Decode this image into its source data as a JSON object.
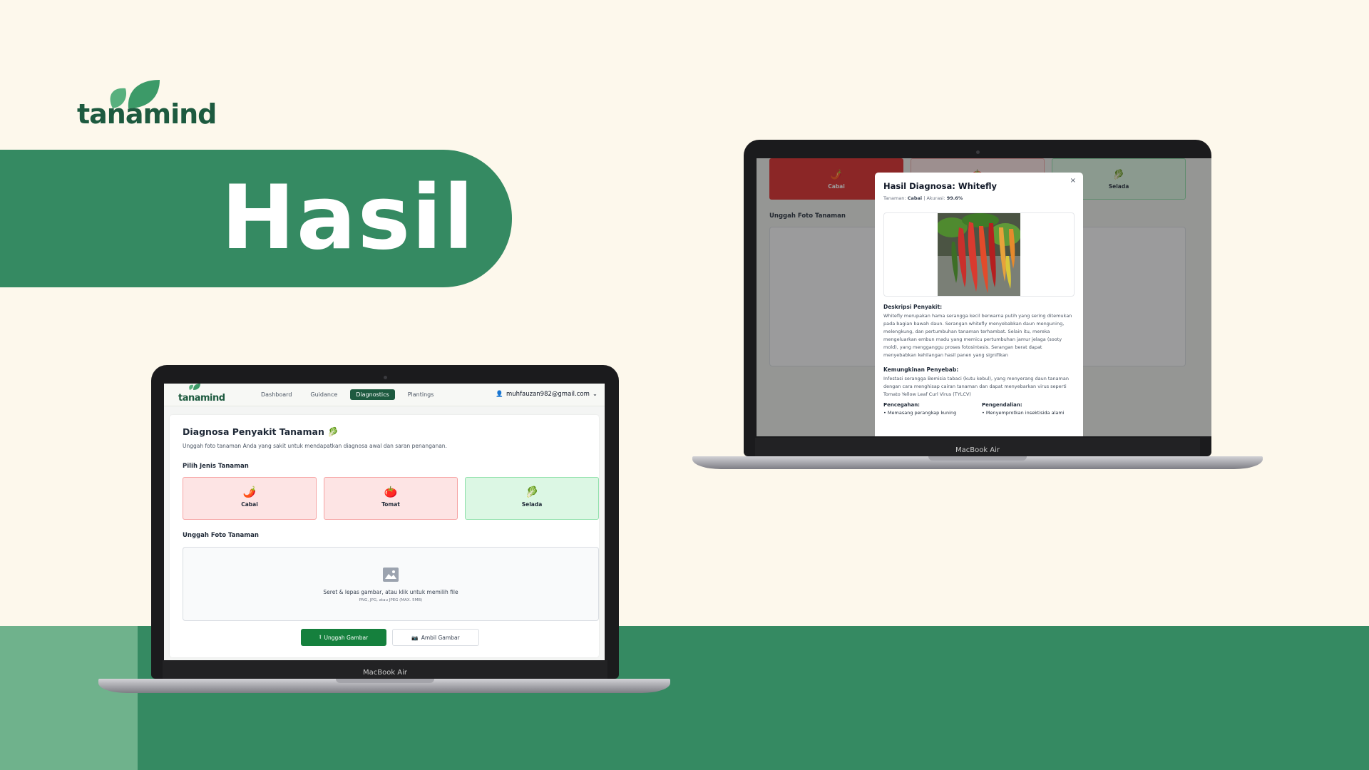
{
  "brand": {
    "name": "tanamind"
  },
  "hero": {
    "title": "Hasil"
  },
  "laptop_left": {
    "device_label": "MacBook Air",
    "nav": {
      "logo": "tanamind",
      "links": [
        "Dashboard",
        "Guidance",
        "Diagnostics",
        "Plantings"
      ],
      "active": "Diagnostics",
      "user_email": "muhfauzan982@gmail.com"
    },
    "page": {
      "title": "Diagnosa Penyakit Tanaman 🥬",
      "subtitle": "Unggah foto tanaman Anda yang sakit untuk mendapatkan diagnosa awal dan saran penanganan.",
      "select_label": "Pilih Jenis Tanaman",
      "plants": [
        {
          "emoji": "🌶️",
          "label": "Cabai"
        },
        {
          "emoji": "🍅",
          "label": "Tomat"
        },
        {
          "emoji": "🥬",
          "label": "Selada"
        }
      ],
      "upload_label": "Unggah Foto Tanaman",
      "upload_hint": "Seret & lepas gambar, atau klik untuk memilih file",
      "upload_formats": "PNG, JPG, atau JPEG (MAX. 5MB)",
      "upload_button": "Unggah Gambar",
      "camera_button": "Ambil Gambar"
    }
  },
  "laptop_right": {
    "device_label": "MacBook Air",
    "background": {
      "plants": [
        {
          "emoji": "🌶️",
          "label": "Cabai"
        },
        {
          "emoji": "🍅",
          "label": ""
        },
        {
          "emoji": "🥬",
          "label": "Selada"
        }
      ],
      "upload_label": "Unggah Foto Tanaman"
    },
    "modal": {
      "title": "Hasil Diagnosa: Whitefly",
      "close": "×",
      "meta_plant_label": "Tanaman:",
      "meta_plant": "Cabai",
      "meta_acc_label": "| Akurasi:",
      "meta_acc": "99.6%",
      "desc_heading": "Deskripsi Penyakit:",
      "desc_text": "Whitefly merupakan hama serangga kecil berwarna putih yang sering ditemukan pada bagian bawah daun. Serangan whitefly menyebabkan daun menguning, melengkung, dan pertumbuhan tanaman terhambat. Selain itu, mereka mengeluarkan embun madu yang memicu pertumbuhan jamur jelaga (sooty mold), yang mengganggu proses fotosintesis. Serangan berat dapat menyebabkan kehilangan hasil panen yang signifikan",
      "cause_heading": "Kemungkinan Penyebab:",
      "cause_text": "Infestasi serangga Bemisia tabaci (kutu kebul), yang menyerang daun tanaman dengan cara menghisap cairan tanaman dan dapat menyebarkan virus seperti Tomato Yellow Leaf Curl Virus (TYLCV)",
      "prevent_heading": "Pencegahan:",
      "prevent_item": "Memasang perangkap kuning",
      "control_heading": "Pengendalian:",
      "control_item": "Menyemprotkan insektisida alami"
    }
  },
  "colors": {
    "brand_green": "#358a62",
    "dark_green": "#1d5a3f",
    "cream": "#fdf8ec",
    "button_green": "#15803d"
  }
}
